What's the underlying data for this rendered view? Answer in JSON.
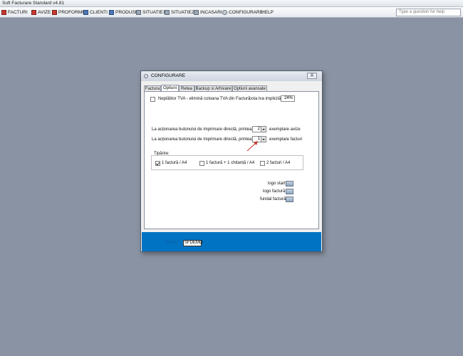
{
  "window": {
    "title": "Soft Facturare Standard v4.81"
  },
  "menu": {
    "items": [
      {
        "label": "FACTURI",
        "icon": "invoice-icon",
        "color": "red"
      },
      {
        "label": "AVIZE",
        "icon": "delivery-note-icon",
        "color": "red"
      },
      {
        "label": "PROFORME",
        "icon": "proforma-icon",
        "color": "red"
      },
      {
        "label": "CLIENTI",
        "icon": "clients-icon",
        "color": "blue"
      },
      {
        "label": "PRODUSE",
        "icon": "products-icon",
        "color": "blue"
      },
      {
        "label": "SITUATIE1",
        "icon": "report-icon",
        "color": "gray"
      },
      {
        "label": "SITUATIE2",
        "icon": "report-icon",
        "color": "gray"
      },
      {
        "label": "INCASARI",
        "icon": "payments-icon",
        "color": "gray"
      },
      {
        "label": "CONFIGURARE",
        "icon": "gear-icon",
        "color": "gear"
      },
      {
        "label": "HELP",
        "icon": "",
        "color": ""
      }
    ],
    "help_placeholder": "Type a question for help"
  },
  "dialog": {
    "title": "CONFIGURARE",
    "close_label": "X",
    "tabs": [
      "Factura",
      "Optiuni",
      "Retea",
      "Backup si Arhivare",
      "Optiuni avansate"
    ],
    "active_tab": "Optiuni",
    "tva_checkbox_label": "Neplătitor TVA - elimină coloana TVA din Factură",
    "tva_checked": false,
    "cota_label": "cota tva implicită",
    "cota_value": "24%",
    "print_avize_label": "La acționarea butonului de imprimare directă, printează:",
    "print_avize_value": "2",
    "print_avize_suffix": "exemplare avize",
    "print_facturi_label": "La acționarea butonului de imprimare directă, printează:",
    "print_facturi_value": "1",
    "print_facturi_suffix": "exemplare facturi",
    "tiparire": {
      "label": "Tipărire:",
      "options": [
        {
          "label": "1 factură / A4",
          "checked": true
        },
        {
          "label": "1 factură + 1 chitanță / A4",
          "checked": false
        },
        {
          "label": "2 facturi / A4",
          "checked": false
        }
      ]
    },
    "image_buttons": [
      {
        "label": "logo start"
      },
      {
        "label": "logo factură"
      },
      {
        "label": "fundal factură"
      }
    ],
    "firma_label": "Firma:",
    "firma_value": "SFDEMO"
  },
  "colors": {
    "desktop": "#8a93a3",
    "band": "#0073c3",
    "arrow": "#c0392b"
  }
}
